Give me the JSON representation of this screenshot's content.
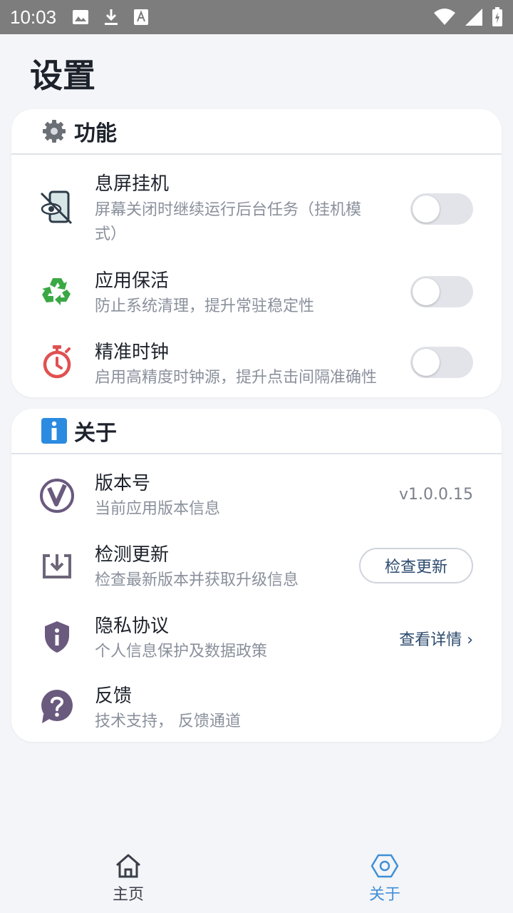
{
  "status_bar": {
    "time": "10:03"
  },
  "page": {
    "title": "设置"
  },
  "functions": {
    "title": "功能",
    "items": [
      {
        "title": "息屏挂机",
        "desc_line1": "屏幕关闭时继续运行后台任务（挂机模",
        "desc_line2": "式）",
        "enabled": false
      },
      {
        "title": "应用保活",
        "desc": "防止系统清理，提升常驻稳定性",
        "enabled": false
      },
      {
        "title": "精准时钟",
        "desc": "启用高精度时钟源，提升点击间隔准确性",
        "enabled": false
      }
    ]
  },
  "about": {
    "title": "关于",
    "version": {
      "title": "版本号",
      "desc": "当前应用版本信息",
      "value": "v1.0.0.15"
    },
    "update": {
      "title": "检测更新",
      "desc": "检查最新版本并获取升级信息",
      "button": "检查更新"
    },
    "privacy": {
      "title": "隐私协议",
      "desc": "个人信息保护及数据政策",
      "link": "查看详情 ›"
    },
    "feedback": {
      "title": "反馈",
      "desc": "技术支持， 反馈通道"
    }
  },
  "nav": {
    "home": "主页",
    "about": "关于",
    "active": "about"
  },
  "colors": {
    "accent": "#3f8fd6",
    "toggle_off": "#e2e4ea",
    "button_text": "#2c4a6e"
  }
}
